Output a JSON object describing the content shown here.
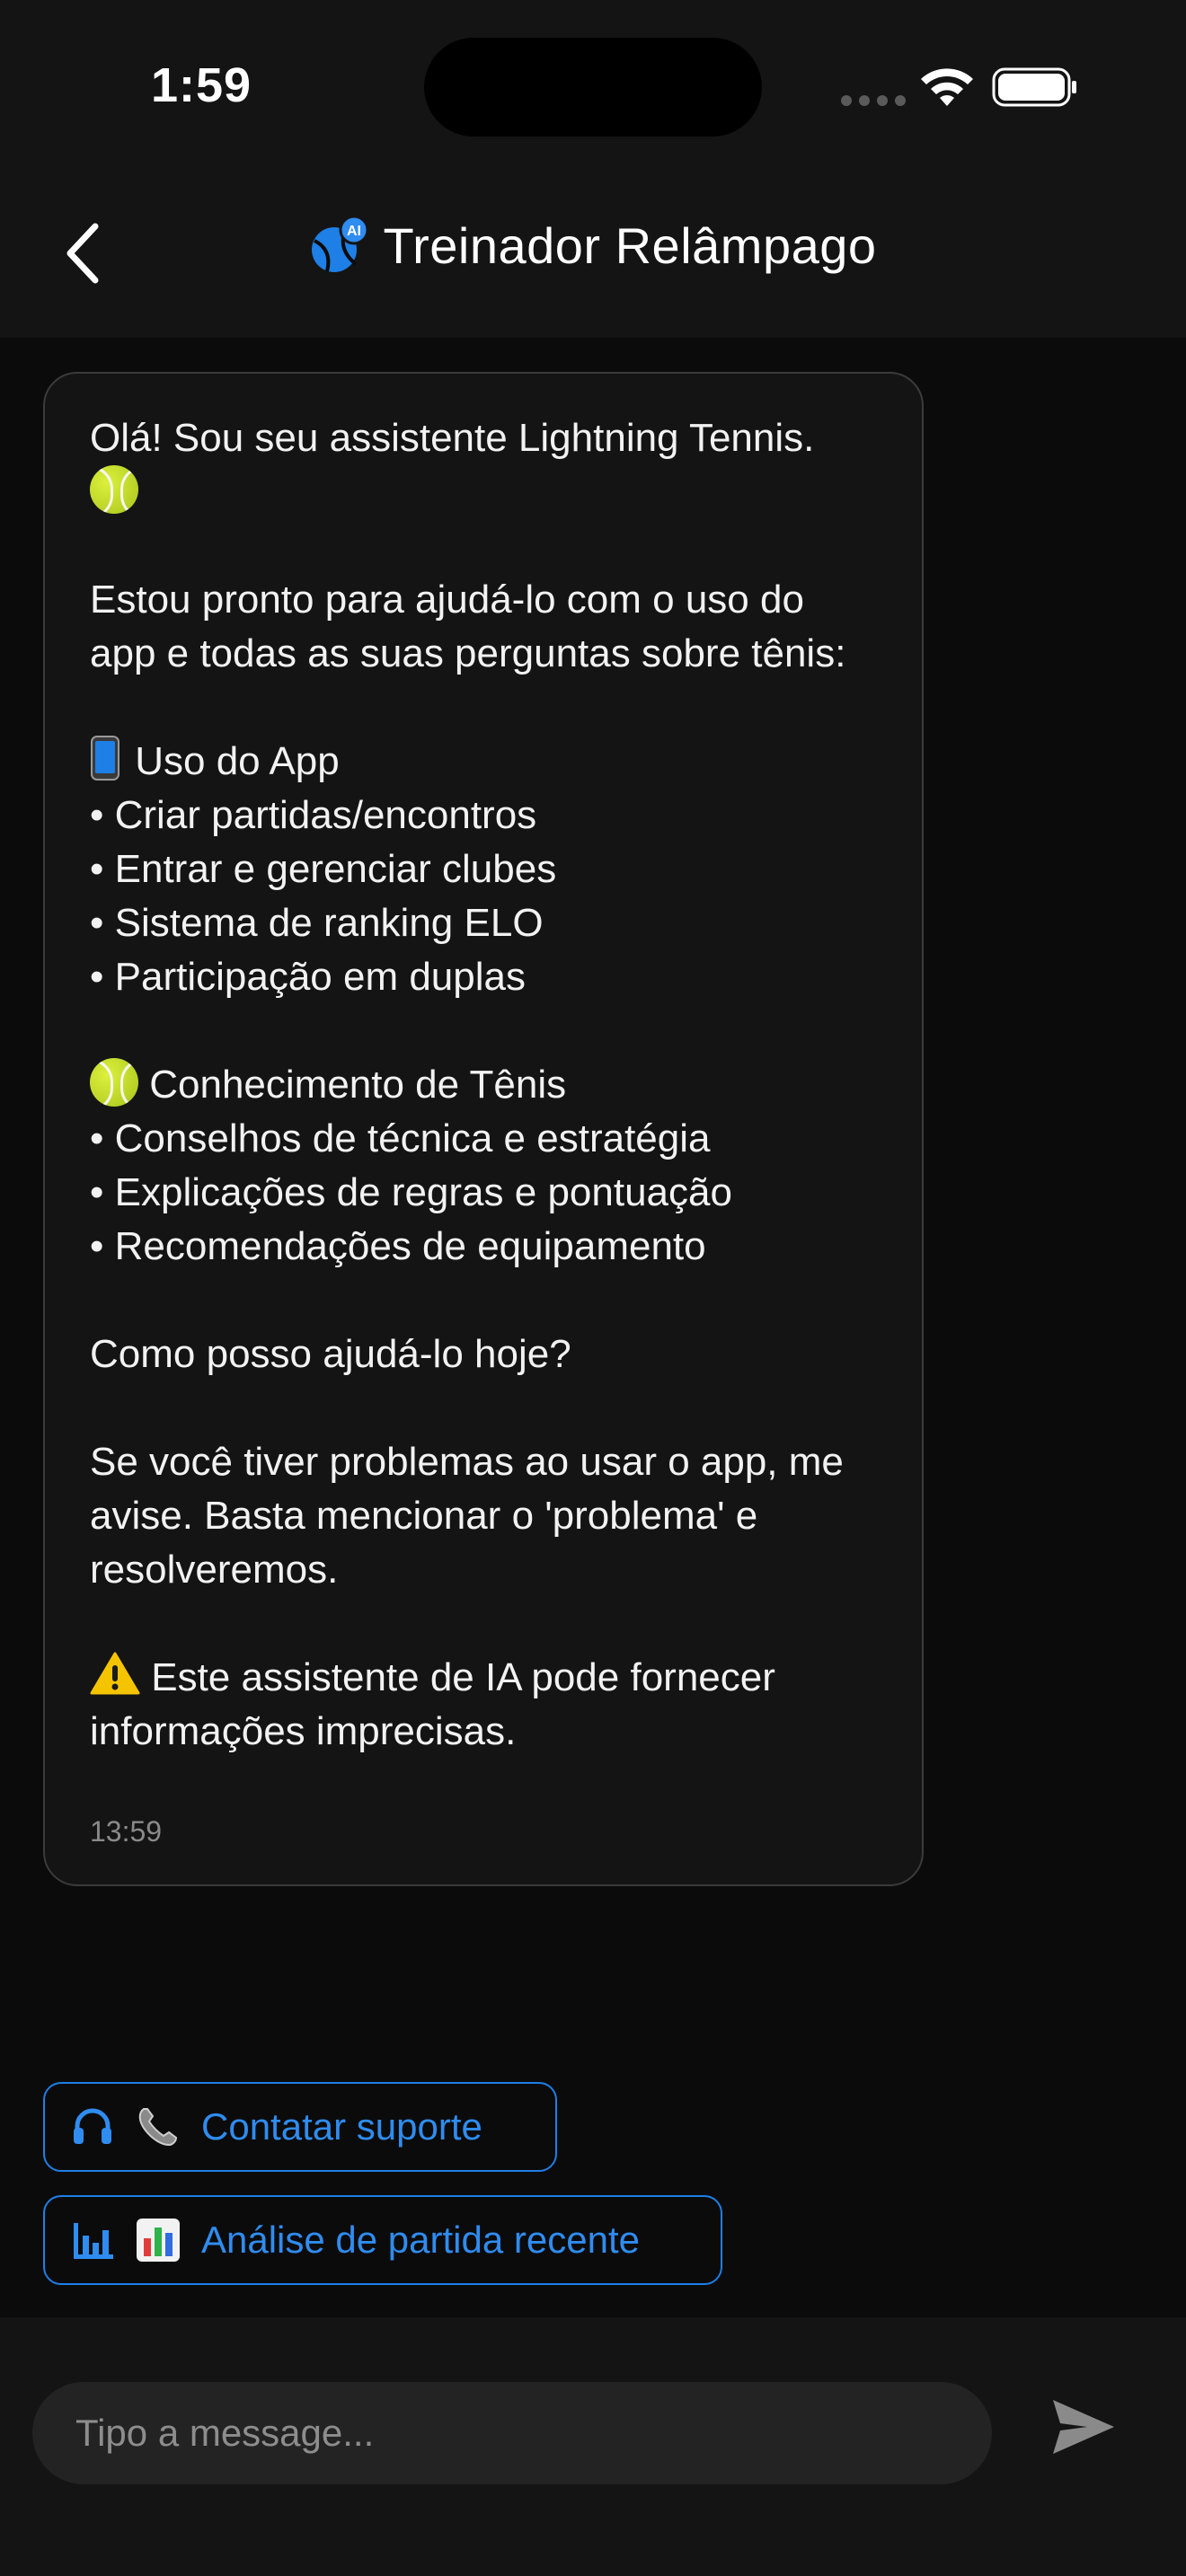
{
  "status_bar": {
    "time": "1:59",
    "wifi_icon": "wifi-icon",
    "battery_icon": "battery-icon"
  },
  "header": {
    "back_icon": "chevron-left-icon",
    "title": "Treinador Relâmpago",
    "coach_icon": "tennis-ai-icon",
    "ai_badge": "AI"
  },
  "message": {
    "greeting": "Olá! Sou seu assistente Lightning Tennis.",
    "intro": "Estou pronto para ajudá-lo com o uso do app e todas as suas perguntas sobre tênis:",
    "section1_title": "Uso do App",
    "section1_items": [
      "• Criar partidas/encontros",
      "• Entrar e gerenciar clubes",
      "• Sistema de ranking ELO",
      "• Participação em duplas"
    ],
    "section2_title": "Conhecimento de Tênis",
    "section2_items": [
      "• Conselhos de técnica e estratégia",
      "• Explicações de regras e pontuação",
      "• Recomendações de equipamento"
    ],
    "question": "Como posso ajudá-lo hoje?",
    "support_note": "Se você tiver problemas ao usar o app, me avise. Basta mencionar o 'problema' e resolveremos.",
    "disclaimer": "Este assistente de IA pode fornecer informações imprecisas.",
    "time": "13:59"
  },
  "quick_actions": {
    "support_label": "Contatar suporte",
    "analysis_label": "Análise de partida recente"
  },
  "composer": {
    "placeholder": "Tipo a message...",
    "send_icon": "send-icon"
  },
  "colors": {
    "accent": "#2f8cf0",
    "background": "#0b0b0b",
    "surface": "#141414"
  }
}
